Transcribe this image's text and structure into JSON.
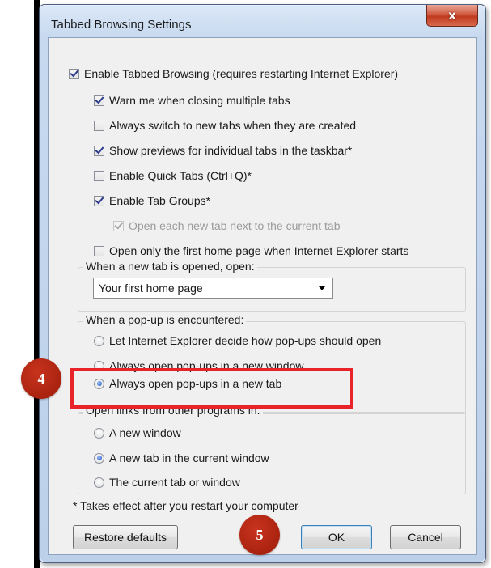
{
  "window": {
    "title": "Tabbed Browsing Settings",
    "close_glyph": "x"
  },
  "tabbed": {
    "enable_label": "Enable Tabbed Browsing (requires restarting Internet Explorer)",
    "enable_checked": true,
    "options": [
      {
        "label": "Warn me when closing multiple tabs",
        "checked": true,
        "enabled": true
      },
      {
        "label": "Always switch to new tabs when they are created",
        "checked": false,
        "enabled": true
      },
      {
        "label": "Show previews for individual tabs in the taskbar*",
        "checked": true,
        "enabled": true
      },
      {
        "label": "Enable Quick Tabs (Ctrl+Q)*",
        "checked": false,
        "enabled": true
      },
      {
        "label": "Enable Tab Groups*",
        "checked": true,
        "enabled": true
      },
      {
        "label": "Open each new tab next to the current tab",
        "checked": true,
        "enabled": false
      },
      {
        "label": "Open only the first home page when Internet Explorer starts",
        "checked": false,
        "enabled": true
      }
    ]
  },
  "new_tab_group": {
    "label": "When a new tab is opened, open:",
    "selected": "Your first home page"
  },
  "popup_group": {
    "label": "When a pop-up is encountered:",
    "options": [
      {
        "label": "Let Internet Explorer decide how pop-ups should open",
        "checked": false
      },
      {
        "label": "Always open pop-ups in a new window",
        "checked": false
      },
      {
        "label": "Always open pop-ups in a new tab",
        "checked": true
      }
    ]
  },
  "links_group": {
    "label": "Open links from other programs in:",
    "options": [
      {
        "label": "A new window",
        "checked": false
      },
      {
        "label": "A new tab in the current window",
        "checked": true
      },
      {
        "label": "The current tab or window",
        "checked": false
      }
    ]
  },
  "footnote": "* Takes effect after you restart your computer",
  "buttons": {
    "restore": "Restore defaults",
    "ok": "OK",
    "cancel": "Cancel"
  },
  "annotations": {
    "step4": "4",
    "step5": "5",
    "highlight_color": "#e8232a",
    "badge_color": "#b0260f"
  }
}
